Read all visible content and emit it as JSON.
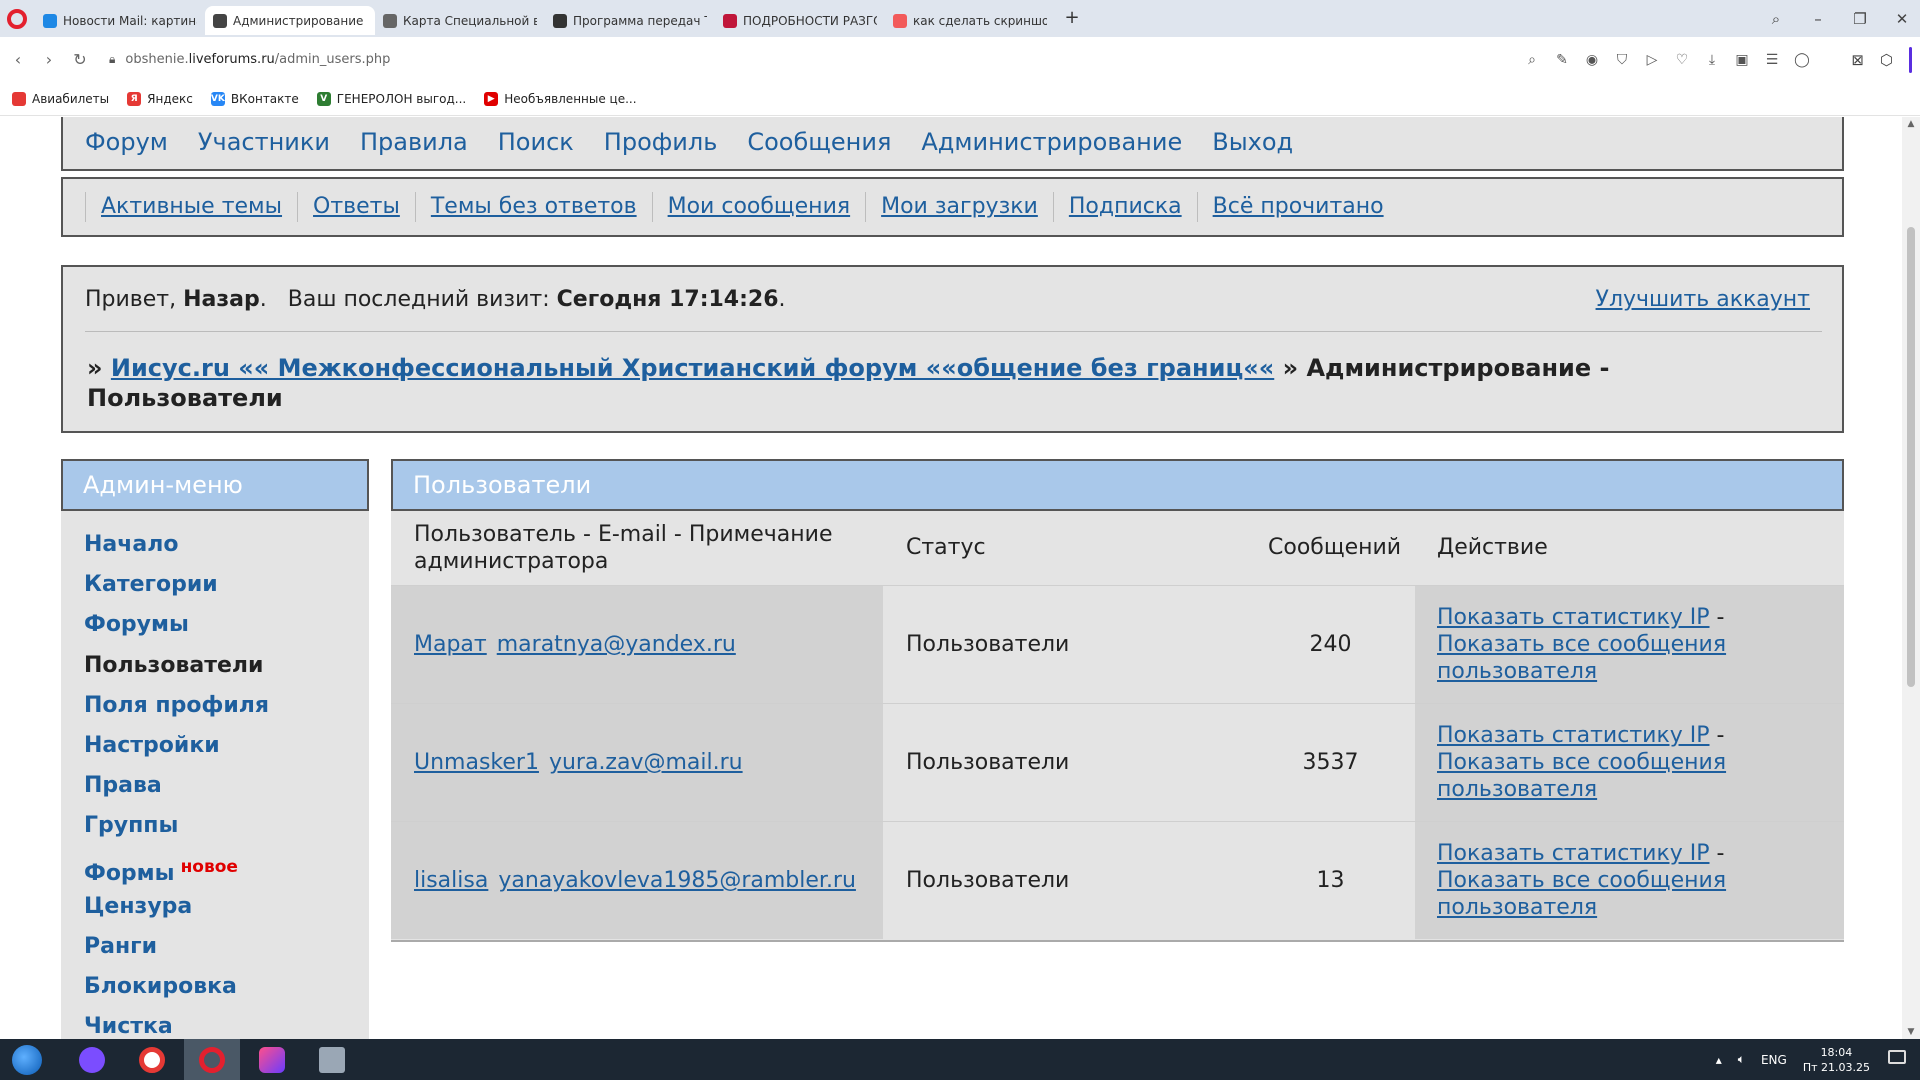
{
  "browser": {
    "tabs": [
      {
        "title": "Новости Mail: картина дня",
        "icon_color": "#1e88e5",
        "active": false
      },
      {
        "title": "Администрирование - Пользователи",
        "icon_color": "#444444",
        "active": true
      },
      {
        "title": "Карта Специальной военной",
        "icon_color": "#666666",
        "active": false
      },
      {
        "title": "Программа передач ТВ на",
        "icon_color": "#333333",
        "active": false
      },
      {
        "title": "ПОДРОБНОСТИ РАЗГОВОРА",
        "icon_color": "#c0163a",
        "active": false
      },
      {
        "title": "как сделать скриншот на",
        "icon_color": "#f25a5a",
        "active": false
      }
    ],
    "new_tab": "+",
    "url_host": "obshenie.",
    "url_domain": "liveforums.ru",
    "url_path": "/admin_users.php",
    "bookmarks": [
      {
        "label": "Авиабилеты",
        "icon_color": "#e53935",
        "glyph": ""
      },
      {
        "label": "Яндекс",
        "icon_color": "#e53935",
        "glyph": "Я"
      },
      {
        "label": "ВКонтакте",
        "icon_color": "#2787f5",
        "glyph": "VK"
      },
      {
        "label": "ГЕНЕРОЛОН выгод...",
        "icon_color": "#2e7d32",
        "glyph": "V"
      },
      {
        "label": "Необъявленные це...",
        "icon_color": "#e00000",
        "glyph": "▶"
      }
    ]
  },
  "forum": {
    "main_nav": [
      "Форум",
      "Участники",
      "Правила",
      "Поиск",
      "Профиль",
      "Сообщения",
      "Администрирование",
      "Выход"
    ],
    "sub_nav": [
      "Активные темы",
      "Ответы",
      "Темы без ответов",
      "Мои сообщения",
      "Мои загрузки",
      "Подписка",
      "Всё прочитано"
    ],
    "welcome": {
      "greeting": "Привет,",
      "username": "Назар",
      "last_visit_label": "Ваш последний визит:",
      "last_visit_value": "Сегодня 17:14:26",
      "upgrade_link": "Улучшить аккаунт"
    },
    "breadcrumb": {
      "prefix": "»",
      "forum_link": "Иисус.ru «« Межконфессиональный Христианский форум ««общение без границ««",
      "separator": "»",
      "current": "Администрирование - Пользователи"
    },
    "admin_menu": {
      "title": "Админ-меню",
      "items": [
        {
          "label": "Начало",
          "current": false,
          "badge": ""
        },
        {
          "label": "Категории",
          "current": false,
          "badge": ""
        },
        {
          "label": "Форумы",
          "current": false,
          "badge": ""
        },
        {
          "label": "Пользователи",
          "current": true,
          "badge": ""
        },
        {
          "label": "Поля профиля",
          "current": false,
          "badge": ""
        },
        {
          "label": "Настройки",
          "current": false,
          "badge": ""
        },
        {
          "label": "Права",
          "current": false,
          "badge": ""
        },
        {
          "label": "Группы",
          "current": false,
          "badge": ""
        },
        {
          "label": "Формы",
          "current": false,
          "badge": "новое"
        },
        {
          "label": "Цензура",
          "current": false,
          "badge": ""
        },
        {
          "label": "Ранги",
          "current": false,
          "badge": ""
        },
        {
          "label": "Блокировка",
          "current": false,
          "badge": ""
        },
        {
          "label": "Чистка",
          "current": false,
          "badge": ""
        }
      ]
    },
    "users_panel": {
      "title": "Пользователи",
      "columns": [
        "Пользователь - E-mail - Примечание администратора",
        "Статус",
        "Сообщений",
        "Действие"
      ],
      "rows": [
        {
          "name": "Марат",
          "email": "maratnya@yandex.ru",
          "status": "Пользователи",
          "posts": "240"
        },
        {
          "name": "Unmasker1",
          "email": "yura.zav@mail.ru",
          "status": "Пользователи",
          "posts": "3537"
        },
        {
          "name": "lisalisa",
          "email": "yanayakovleva1985@rambler.ru",
          "status": "Пользователи",
          "posts": "13"
        }
      ],
      "action_ip": "Показать статистику IP",
      "action_sep": "-",
      "action_posts": "Показать все сообщения пользователя"
    }
  },
  "taskbar": {
    "language": "ENG",
    "time": "18:04",
    "date": "Пт 21.03.25"
  },
  "colors": {
    "link": "#1e5f9e",
    "panel_header": "#a9c8ea",
    "panel_bg": "#e4e4e4",
    "new_badge": "#e00000"
  }
}
